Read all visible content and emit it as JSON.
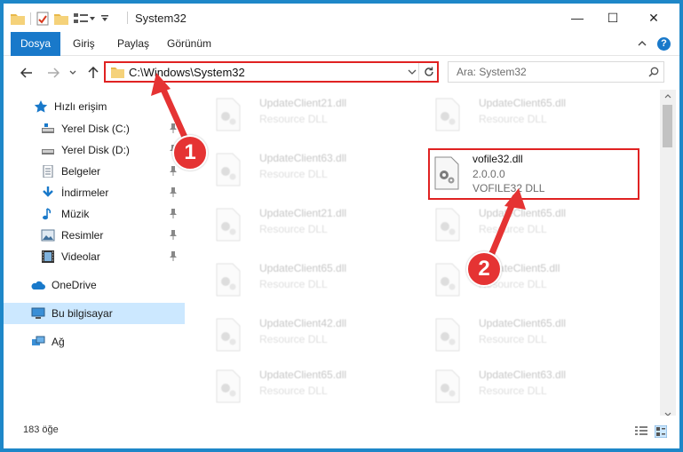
{
  "window": {
    "title": "System32",
    "minimize": "—",
    "maximize": "☐",
    "close": "✕"
  },
  "ribbon": {
    "tabs": [
      {
        "label": "Dosya"
      },
      {
        "label": "Giriş"
      },
      {
        "label": "Paylaş"
      },
      {
        "label": "Görünüm"
      }
    ],
    "help": "?"
  },
  "address": {
    "path": "C:\\Windows\\System32",
    "search_placeholder": "Ara: System32"
  },
  "sidebar": {
    "items": [
      {
        "label": "Hızlı erişim"
      },
      {
        "label": "Yerel Disk (C:)"
      },
      {
        "label": "Yerel Disk (D:)"
      },
      {
        "label": "Belgeler"
      },
      {
        "label": "İndirmeler"
      },
      {
        "label": "Müzik"
      },
      {
        "label": "Resimler"
      },
      {
        "label": "Videolar"
      },
      {
        "label": "OneDrive"
      },
      {
        "label": "Bu bilgisayar"
      },
      {
        "label": "Ağ"
      }
    ]
  },
  "files": {
    "left": [
      {
        "name": "UpdateClient21.dll",
        "type": "Resource DLL"
      },
      {
        "name": "UpdateClient63.dll",
        "type": "Resource DLL"
      },
      {
        "name": "UpdateClient21.dll",
        "type": "Resource DLL"
      },
      {
        "name": "UpdateClient65.dll",
        "type": "Resource DLL"
      },
      {
        "name": "UpdateClient42.dll",
        "type": "Resource DLL"
      },
      {
        "name": "UpdateClient65.dll",
        "type": "Resource DLL"
      }
    ],
    "right": [
      {
        "name": "UpdateClient65.dll",
        "type": "Resource DLL"
      },
      {
        "name": "UpdateClient65.dll",
        "type": "Resource DLL"
      },
      {
        "name": "UpdateClient5.dll",
        "type": "Resource DLL"
      },
      {
        "name": "UpdateClient65.dll",
        "type": "Resource DLL"
      },
      {
        "name": "UpdateClient63.dll",
        "type": "Resource DLL"
      }
    ],
    "highlighted": {
      "name": "vofile32.dll",
      "version": "2.0.0.0",
      "description": "VOFILE32 DLL"
    }
  },
  "status": {
    "count": "183 öğe"
  },
  "callouts": [
    "1",
    "2"
  ],
  "colors": {
    "accent": "#1979ca",
    "highlight": "#e02222",
    "callout": "#e53333",
    "selected": "#cce8ff"
  }
}
